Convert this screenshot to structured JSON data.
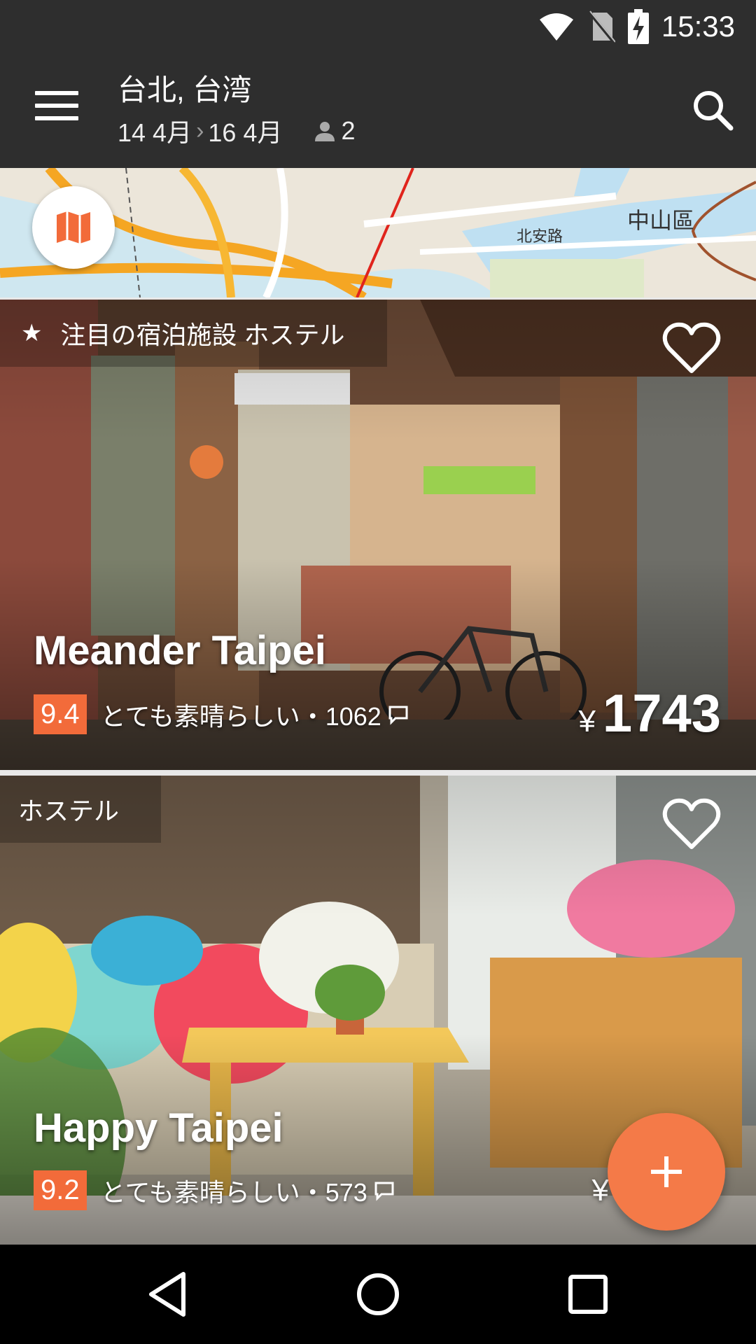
{
  "status_bar": {
    "time": "15:33",
    "icons": [
      "wifi-icon",
      "no-sim-icon",
      "battery-charging-icon"
    ]
  },
  "header": {
    "city": "台北, 台湾",
    "check_in": "14 4月",
    "check_out": "16 4月",
    "guests": "2"
  },
  "map": {
    "labels": [
      "中山區",
      "北安路"
    ]
  },
  "listings": [
    {
      "tag": "注目の宿泊施設 ホステル",
      "name": "Meander Taipei",
      "score": "9.4",
      "rating_text": "とても素晴らしい・1062",
      "currency": "¥",
      "price": "1743"
    },
    {
      "tag": "ホステル",
      "name": "Happy Taipei",
      "score": "9.2",
      "rating_text": "とても素晴らしい・573",
      "currency": "¥",
      "price": ""
    }
  ],
  "colors": {
    "accent": "#f26b3a",
    "fab": "#f47a48",
    "toolbar": "#2e2e2e"
  }
}
